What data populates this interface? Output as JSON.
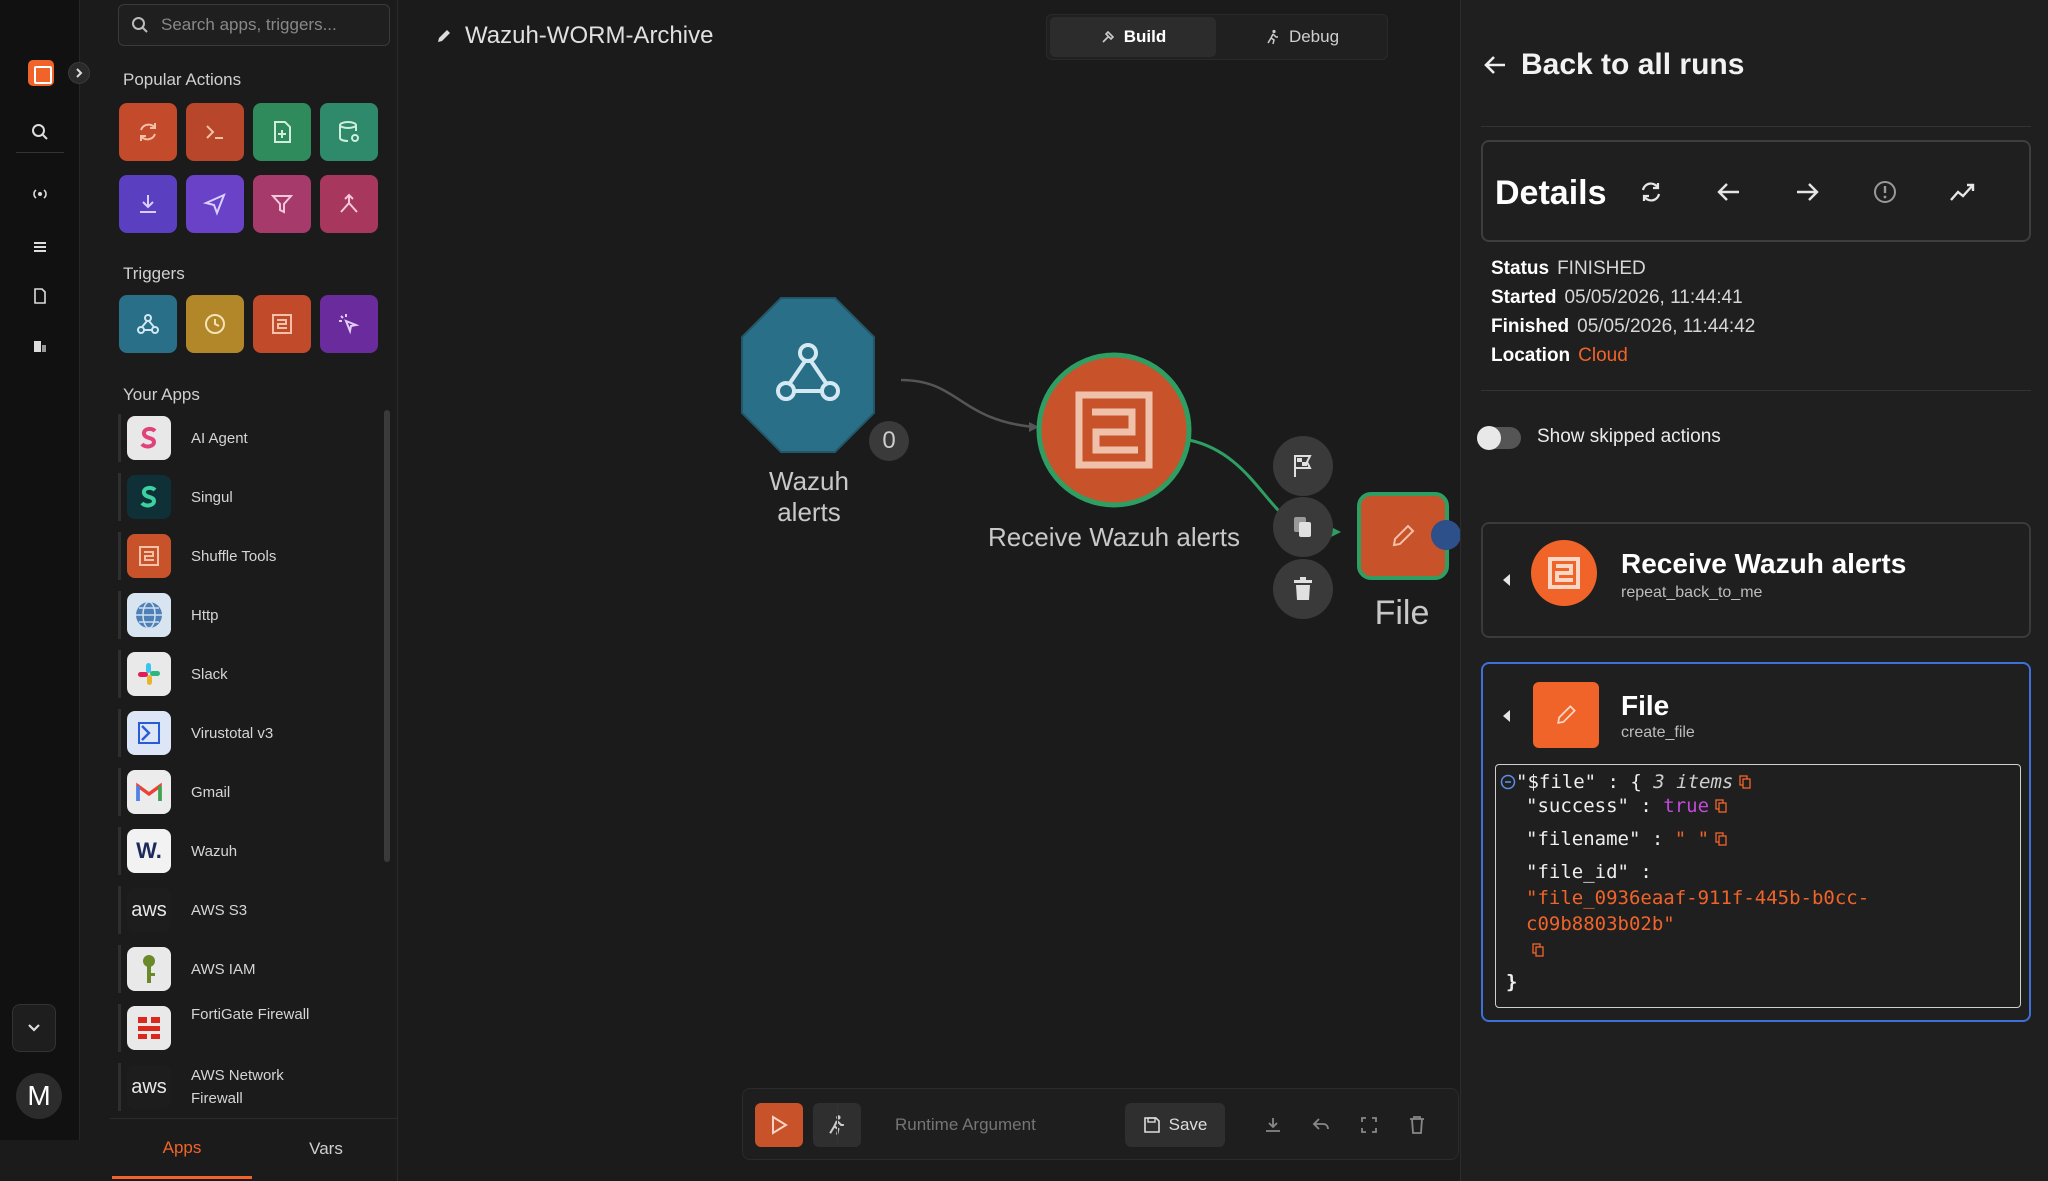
{
  "search": {
    "placeholder": "Search apps, triggers..."
  },
  "sidebar": {
    "popular_title": "Popular Actions",
    "triggers_title": "Triggers",
    "your_apps_title": "Your Apps",
    "apps": [
      {
        "label": "AI Agent",
        "icon": "ai-agent-icon"
      },
      {
        "label": "Singul",
        "icon": "singul-icon"
      },
      {
        "label": "Shuffle Tools",
        "icon": "shuffle-tools-icon"
      },
      {
        "label": "Http",
        "icon": "globe-icon"
      },
      {
        "label": "Slack",
        "icon": "slack-icon"
      },
      {
        "label": "Virustotal v3",
        "icon": "virustotal-icon"
      },
      {
        "label": "Gmail",
        "icon": "gmail-icon"
      },
      {
        "label": "Wazuh",
        "icon": "wazuh-icon",
        "glyph": "W."
      },
      {
        "label": "AWS S3",
        "icon": "aws-icon",
        "glyph": "aws"
      },
      {
        "label": "AWS IAM",
        "icon": "aws-iam-icon"
      },
      {
        "label": "FortiGate Firewall",
        "icon": "fortinet-icon"
      },
      {
        "label": "AWS Network Firewall",
        "icon": "aws-icon",
        "glyph": "aws"
      }
    ],
    "tabs": [
      "Apps",
      "Vars"
    ]
  },
  "rail": {
    "avatar": "M"
  },
  "canvas": {
    "workflow_name": "Wazuh-WORM-Archive",
    "mode_build": "Build",
    "mode_debug": "Debug",
    "nodes": {
      "trigger": "Wazuh alerts",
      "trigger_count": "0",
      "receive": "Receive Wazuh alerts",
      "file": "File"
    },
    "runtime_placeholder": "Runtime Argument",
    "save_label": "Save"
  },
  "panel": {
    "back_label": "Back to all runs",
    "details_title": "Details",
    "status_key": "Status",
    "status_val": "FINISHED",
    "started_key": "Started",
    "started_val": "05/05/2026, 11:44:41",
    "finished_key": "Finished",
    "finished_val": "05/05/2026, 11:44:42",
    "location_key": "Location",
    "location_val": "Cloud",
    "toggle_label": "Show skipped actions",
    "actions": [
      {
        "title": "Receive Wazuh alerts",
        "subtitle": "repeat_back_to_me"
      },
      {
        "title": "File",
        "subtitle": "create_file"
      }
    ],
    "json": {
      "root_key": "\"$file\"",
      "count": "3 items",
      "k_success": "\"success\"",
      "v_success": "true",
      "k_filename": "\"filename\"",
      "v_filename": "\" \"",
      "k_file_id": "\"file_id\"",
      "v_file_id_1": "\"file_0936eaaf-911f-445b-b0cc-",
      "v_file_id_2": "c09b8803b02b\""
    }
  },
  "colors": {
    "accent": "#f0642a",
    "selected_border": "#3f6fd8",
    "edge": "#2f9e63"
  }
}
